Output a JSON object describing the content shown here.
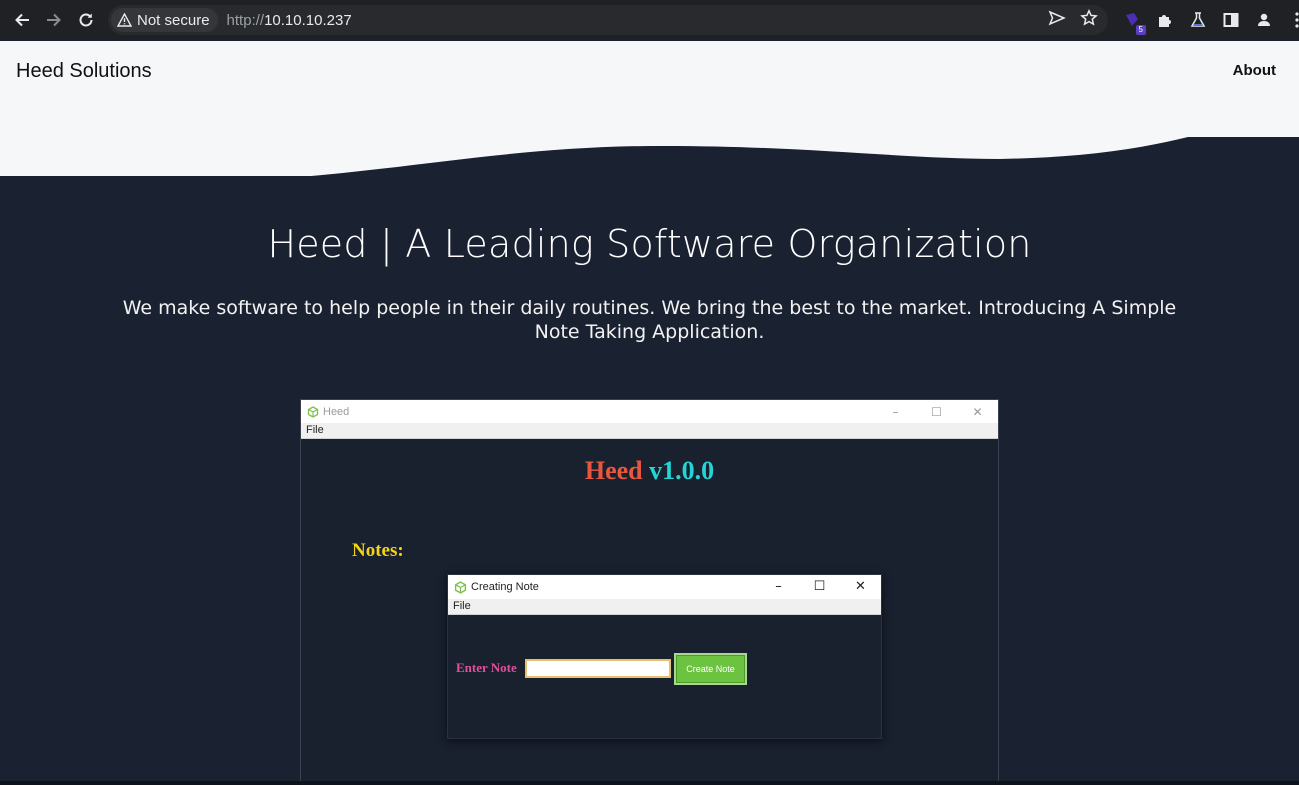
{
  "browser": {
    "security_label": "Not secure",
    "url_scheme": "http://",
    "url_host": "10.10.10.237",
    "extension_badge": "5"
  },
  "site": {
    "brand": "Heed Solutions",
    "nav_about": "About",
    "hero_title": "Heed | A Leading Software Organization",
    "hero_subtitle": "We make software to help people in their daily routines. We bring the best to the market. Introducing A Simple Note Taking Application."
  },
  "app_screenshot": {
    "window_title": "Heed",
    "menu_file": "File",
    "app_name": "Heed",
    "app_version": "v1.0.0",
    "notes_label": "Notes:",
    "dialog": {
      "title": "Creating Note",
      "menu_file": "File",
      "enter_label": "Enter Note",
      "input_value": "",
      "button_label": "Create Note"
    }
  },
  "colors": {
    "page_bg": "#1a2130",
    "header_bg": "#f6f7f9",
    "app_name": "#e8563e",
    "app_version": "#22d6d6",
    "notes_label": "#f3d416",
    "enter_label": "#e0509e",
    "button_bg": "#6bc33f"
  }
}
